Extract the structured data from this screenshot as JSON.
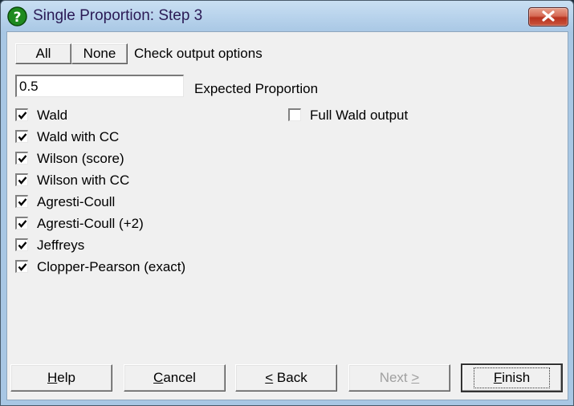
{
  "window": {
    "title": "Single Proportion: Step 3",
    "close_label": "Close"
  },
  "toolbar": {
    "all_label": "All",
    "none_label": "None",
    "check_options_label": "Check output options"
  },
  "expected_proportion": {
    "value": "0.5",
    "label": "Expected Proportion"
  },
  "options": [
    {
      "label": "Wald",
      "checked": true
    },
    {
      "label": "Wald with CC",
      "checked": true
    },
    {
      "label": "Wilson (score)",
      "checked": true
    },
    {
      "label": "Wilson with CC",
      "checked": true
    },
    {
      "label": "Agresti-Coull",
      "checked": true
    },
    {
      "label": "Agresti-Coull (+2)",
      "checked": true
    },
    {
      "label": "Jeffreys",
      "checked": true
    },
    {
      "label": "Clopper-Pearson (exact)",
      "checked": true
    }
  ],
  "full_wald": {
    "label": "Full Wald output",
    "checked": false
  },
  "footer": {
    "help": {
      "mnemonic": "H",
      "rest": "elp"
    },
    "cancel": {
      "mnemonic": "C",
      "rest": "ancel"
    },
    "back": {
      "mnemonic": "<",
      "rest": " Back"
    },
    "next": {
      "pre": "Next ",
      "mnemonic": ">"
    },
    "finish": {
      "mnemonic": "F",
      "rest": "inish"
    }
  }
}
